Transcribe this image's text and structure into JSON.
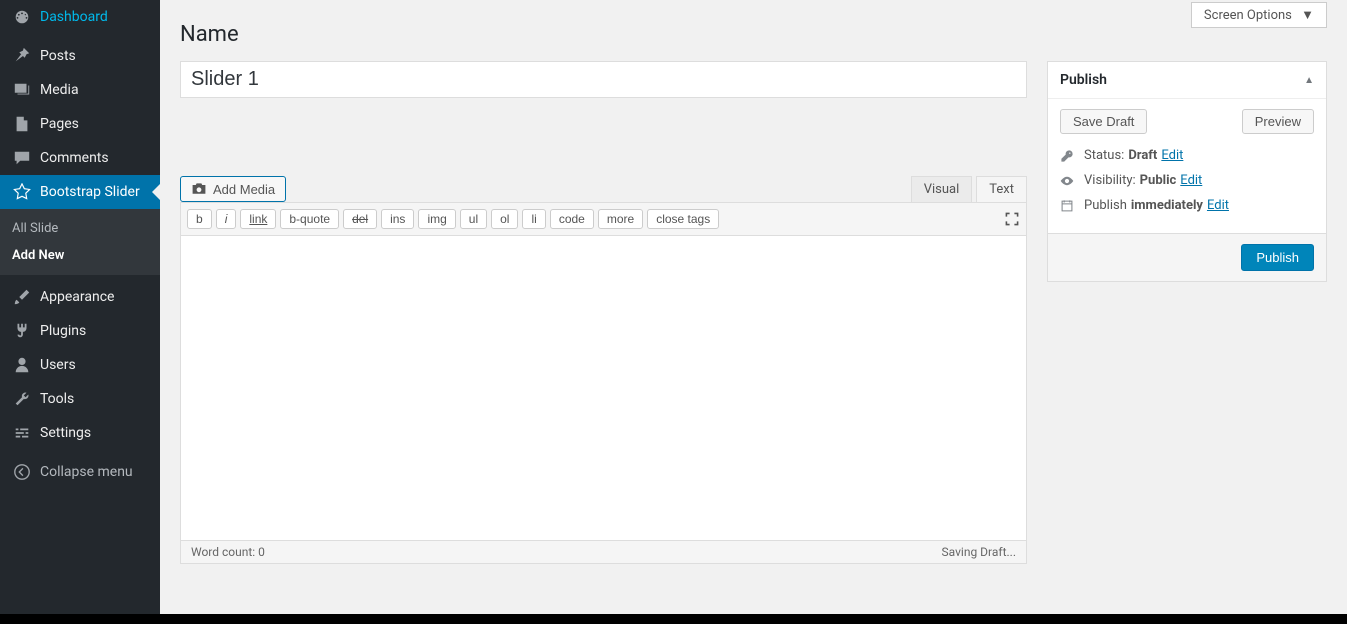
{
  "screen_options": "Screen Options",
  "sidebar": {
    "dashboard": "Dashboard",
    "posts": "Posts",
    "media": "Media",
    "pages": "Pages",
    "comments": "Comments",
    "bootstrap_slider": "Bootstrap Slider",
    "submenu": {
      "all_slide": "All Slide",
      "add_new": "Add New"
    },
    "appearance": "Appearance",
    "plugins": "Plugins",
    "users": "Users",
    "tools": "Tools",
    "settings": "Settings",
    "collapse": "Collapse menu"
  },
  "page": {
    "heading": "Name",
    "title_value": "Slider 1"
  },
  "editor": {
    "add_media": "Add Media",
    "tab_visual": "Visual",
    "tab_text": "Text",
    "quicktags": {
      "b": "b",
      "i": "i",
      "link": "link",
      "bquote": "b-quote",
      "del": "del",
      "ins": "ins",
      "img": "img",
      "ul": "ul",
      "ol": "ol",
      "li": "li",
      "code": "code",
      "more": "more",
      "close": "close tags"
    },
    "content": "",
    "word_count_label": "Word count: 0",
    "saving_draft": "Saving Draft..."
  },
  "publish": {
    "title": "Publish",
    "save_draft": "Save Draft",
    "preview": "Preview",
    "status_label": "Status:",
    "status_value": "Draft",
    "visibility_label": "Visibility:",
    "visibility_value": "Public",
    "schedule_label": "Publish",
    "schedule_value": "immediately",
    "edit": "Edit",
    "publish_btn": "Publish"
  }
}
